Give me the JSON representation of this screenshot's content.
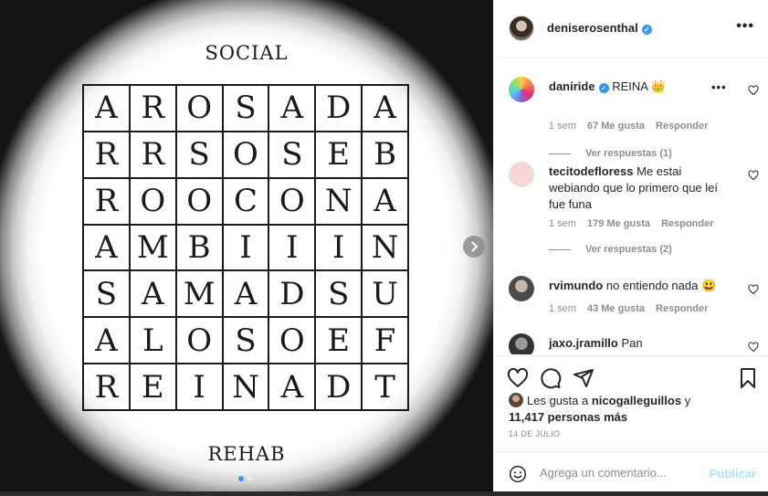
{
  "poster": {
    "top_text": "SOCIAL",
    "bottom_text": "REHAB",
    "grid": [
      [
        "A",
        "R",
        "O",
        "S",
        "A",
        "D",
        "A"
      ],
      [
        "R",
        "R",
        "S",
        "O",
        "S",
        "E",
        "B"
      ],
      [
        "R",
        "O",
        "O",
        "C",
        "O",
        "N",
        "A"
      ],
      [
        "A",
        "M",
        "B",
        "I",
        "I",
        "I",
        "N"
      ],
      [
        "S",
        "A",
        "M",
        "A",
        "D",
        "S",
        "U"
      ],
      [
        "A",
        "L",
        "O",
        "S",
        "O",
        "E",
        "F"
      ],
      [
        "R",
        "E",
        "I",
        "N",
        "A",
        "D",
        "T"
      ]
    ],
    "next_icon": "chevron-right-icon",
    "carousel_count": 2,
    "carousel_active": 1
  },
  "header": {
    "username": "deniserosenthal",
    "verified": true,
    "more_icon": "ellipsis-icon",
    "more_label": "•••"
  },
  "comments": [
    {
      "username": "daniride",
      "verified": true,
      "text": "REINA 👑",
      "age": "1 sem",
      "likes": "67 Me gusta",
      "reply": "Responder",
      "replies": "Ver respuestas (1)",
      "options": "•••"
    },
    {
      "username": "tecitodefloress",
      "verified": false,
      "text": "Me estai webiando que lo primero que leí fue funa",
      "age": "1 sem",
      "likes": "179 Me gusta",
      "reply": "Responder",
      "replies": "Ver respuestas (2)"
    },
    {
      "username": "rvimundo",
      "verified": false,
      "text": "no entiendo nada 😃",
      "age": "1 sem",
      "likes": "43 Me gusta",
      "reply": "Responder"
    },
    {
      "username": "jaxo.jramillo",
      "verified": false,
      "text": "Pan"
    }
  ],
  "actions": {
    "icons": [
      "heart-icon",
      "comment-icon",
      "share-icon",
      "bookmark-icon"
    ]
  },
  "likes": {
    "prefix": "Les gusta a",
    "user": "nicogalleguillos",
    "and": "y",
    "others": "11,417 personas más"
  },
  "date": "14 DE JULIO",
  "comment_box": {
    "placeholder": "Agrega un comentario...",
    "publish": "Publicar"
  },
  "colors": {
    "accent": "#3897f0",
    "publish_disabled": "#b2dffc",
    "muted": "#8e8e8e",
    "text": "#262626"
  }
}
